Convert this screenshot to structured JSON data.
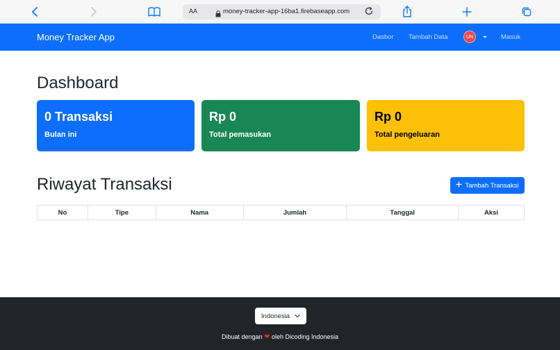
{
  "browser": {
    "text_size_label": "AA",
    "url": "money-tracker-app-16ba1.firebaseapp.com",
    "icons": [
      "back-icon",
      "forward-icon",
      "bookmarks-icon",
      "lock-icon",
      "reload-icon",
      "share-icon",
      "new-tab-icon",
      "tabs-icon"
    ]
  },
  "navbar": {
    "brand": "Money Tracker App",
    "links": [
      "Dasbor",
      "Tambah Data"
    ],
    "avatar_initials": "UN",
    "login": "Masuk",
    "color": "#0d6efd"
  },
  "dashboard": {
    "title": "Dashboard",
    "cards": [
      {
        "value": "0 Transaksi",
        "label": "Bulan ini",
        "color": "#0d6efd"
      },
      {
        "value": "Rp 0",
        "label": "Total pemasukan",
        "color": "#198754"
      },
      {
        "value": "Rp 0",
        "label": "Total pengeluaran",
        "color": "#ffc107"
      }
    ]
  },
  "history": {
    "title": "Riwayat Transaksi",
    "add_button": "Tambah Transaksi",
    "columns": [
      "No",
      "Tipe",
      "Nama",
      "Jumlah",
      "Tanggal",
      "Aksi"
    ],
    "rows": []
  },
  "footer": {
    "language": "Indonesia",
    "credit_prefix": "Dibuat dengan",
    "credit_suffix": "oleh Dicoding Indonesia",
    "heart_color": "#e0242f"
  }
}
